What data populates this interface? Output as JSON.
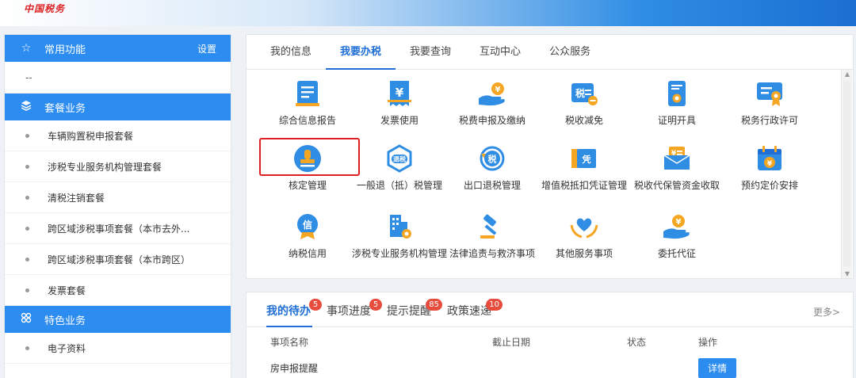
{
  "header": {
    "logo_text": "中国税务"
  },
  "sidebar": {
    "common": {
      "title": "常用功能",
      "setting": "设置",
      "empty": "--"
    },
    "package": {
      "title": "套餐业务",
      "items": [
        "车辆购置税申报套餐",
        "涉税专业服务机构管理套餐",
        "清税注销套餐",
        "跨区域涉税事项套餐（本市去外...",
        "跨区域涉税事项套餐（本市跨区）",
        "发票套餐"
      ]
    },
    "special": {
      "title": "特色业务",
      "items": [
        "电子资料"
      ]
    }
  },
  "main": {
    "tabs": [
      "我的信息",
      "我要办税",
      "我要查询",
      "互动中心",
      "公众服务"
    ],
    "active_tab": 1,
    "services": [
      {
        "label": "综合信息报告",
        "icon": "report-icon"
      },
      {
        "label": "发票使用",
        "icon": "invoice-icon"
      },
      {
        "label": "税费申报及缴纳",
        "icon": "tax-payment-icon"
      },
      {
        "label": "税收减免",
        "icon": "tax-reduction-icon"
      },
      {
        "label": "证明开具",
        "icon": "certificate-icon"
      },
      {
        "label": "税务行政许可",
        "icon": "license-icon"
      },
      {
        "label": "核定管理",
        "icon": "stamp-icon"
      },
      {
        "label": "一般退（抵）税管理",
        "icon": "refund-icon"
      },
      {
        "label": "出口退税管理",
        "icon": "export-refund-icon"
      },
      {
        "label": "增值税抵扣凭证管理",
        "icon": "voucher-icon"
      },
      {
        "label": "税收代保管资金收取",
        "icon": "custody-icon"
      },
      {
        "label": "预约定价安排",
        "icon": "calendar-price-icon"
      },
      {
        "label": "纳税信用",
        "icon": "credit-icon"
      },
      {
        "label": "涉税专业服务机构管理",
        "icon": "building-gear-icon"
      },
      {
        "label": "法律追责与救济事项",
        "icon": "gavel-icon"
      },
      {
        "label": "其他服务事项",
        "icon": "heart-hands-icon"
      },
      {
        "label": "委托代征",
        "icon": "coin-hand-icon"
      }
    ]
  },
  "todo": {
    "tabs": [
      {
        "label": "我的待办",
        "badge": "5"
      },
      {
        "label": "事项进度",
        "badge": "5"
      },
      {
        "label": "提示提醒",
        "badge": "85"
      },
      {
        "label": "政策速递",
        "badge": "10"
      }
    ],
    "more": "更多>",
    "columns": [
      "事项名称",
      "截止日期",
      "状态",
      "操作"
    ],
    "row": {
      "name": "房申报提醒",
      "action": "详情"
    }
  },
  "colors": {
    "primary": "#2d8cf0",
    "accent_red": "#e02020",
    "icon_blue": "#2f8de4",
    "icon_orange": "#f5a623"
  }
}
